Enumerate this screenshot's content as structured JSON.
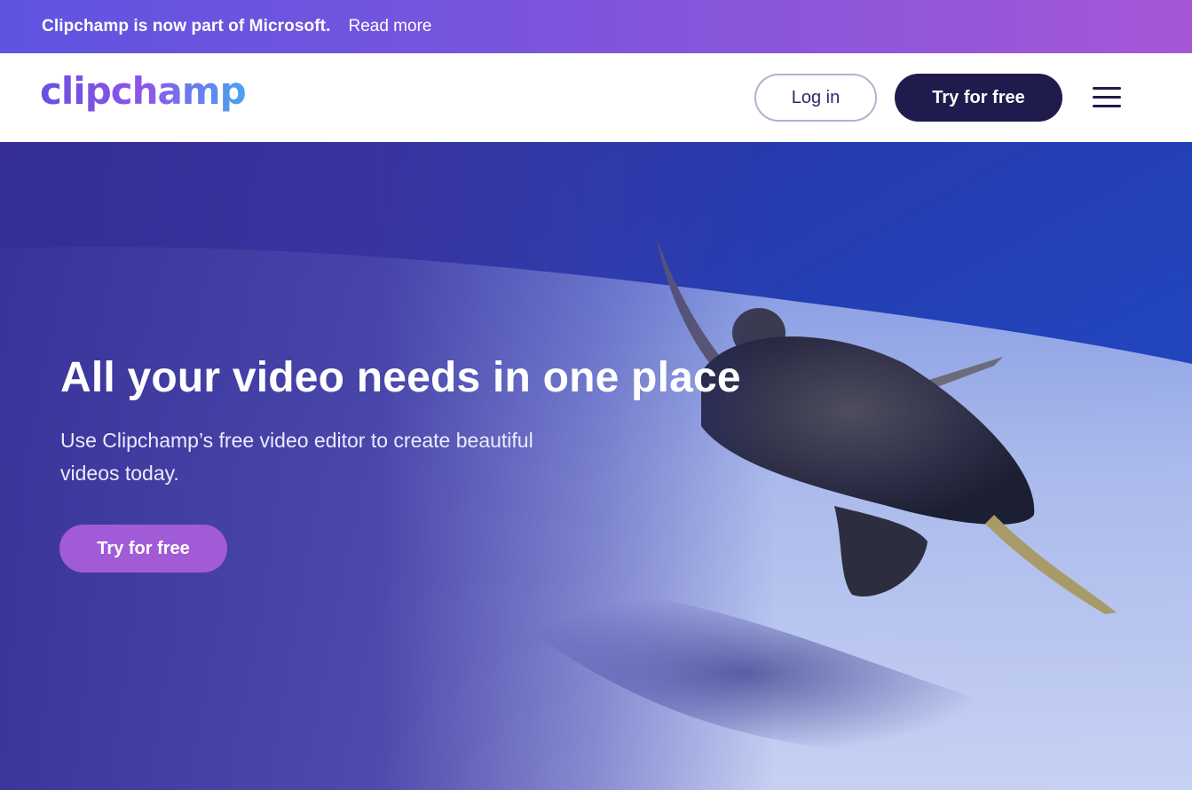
{
  "banner": {
    "text": "Clipchamp is now part of Microsoft.",
    "link": "Read more"
  },
  "header": {
    "logo": "clipchamp",
    "login_label": "Log in",
    "try_label": "Try for free",
    "menu_icon": "hamburger-menu-icon"
  },
  "hero": {
    "title": "All your video needs in one place",
    "subtitle": "Use Clipchamp’s free video editor to create beautiful videos today.",
    "cta_label": "Try for free"
  },
  "colors": {
    "banner_start": "#5e54e0",
    "banner_end": "#a657d9",
    "header_cta": "#1f1b4d",
    "hero_cta": "#a25bd6",
    "hero_overlay": "#342e96"
  }
}
